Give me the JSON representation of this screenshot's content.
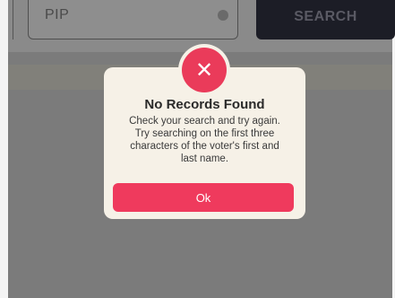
{
  "search": {
    "value": "PIP",
    "button_label": "SEARCH"
  },
  "dialog": {
    "icon": "close-icon",
    "title": "No Records Found",
    "message_lines": [
      "Check your search and try again.",
      "Try searching on the first three",
      "characters of the voter's first and",
      "last name."
    ],
    "ok_label": "Ok"
  },
  "colors": {
    "accent": "#ea3b5a",
    "dialog_background": "#f6f1e7",
    "overlay": "#7b7b7b"
  }
}
